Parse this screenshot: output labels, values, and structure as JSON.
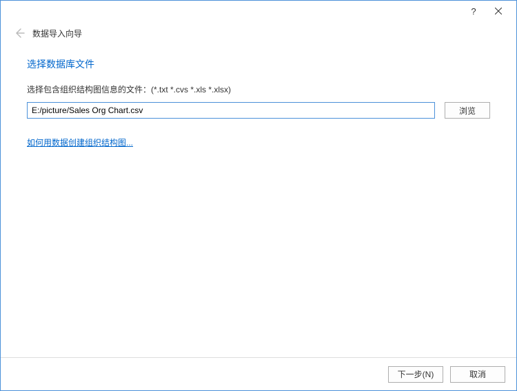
{
  "titlebar": {
    "help_symbol": "?",
    "close_label": "Close"
  },
  "header": {
    "wizard_title": "数据导入向导"
  },
  "content": {
    "section_title": "选择数据库文件",
    "instruction": "选择包含组织结构图信息的文件：(*.txt  *.cvs  *.xls  *.xlsx)",
    "file_path": "E:/picture/Sales Org Chart.csv",
    "browse_label": "浏览",
    "help_link": "如何用数据创建组织结构图..."
  },
  "footer": {
    "next_label": "下一步(N)",
    "cancel_label": "取消"
  }
}
